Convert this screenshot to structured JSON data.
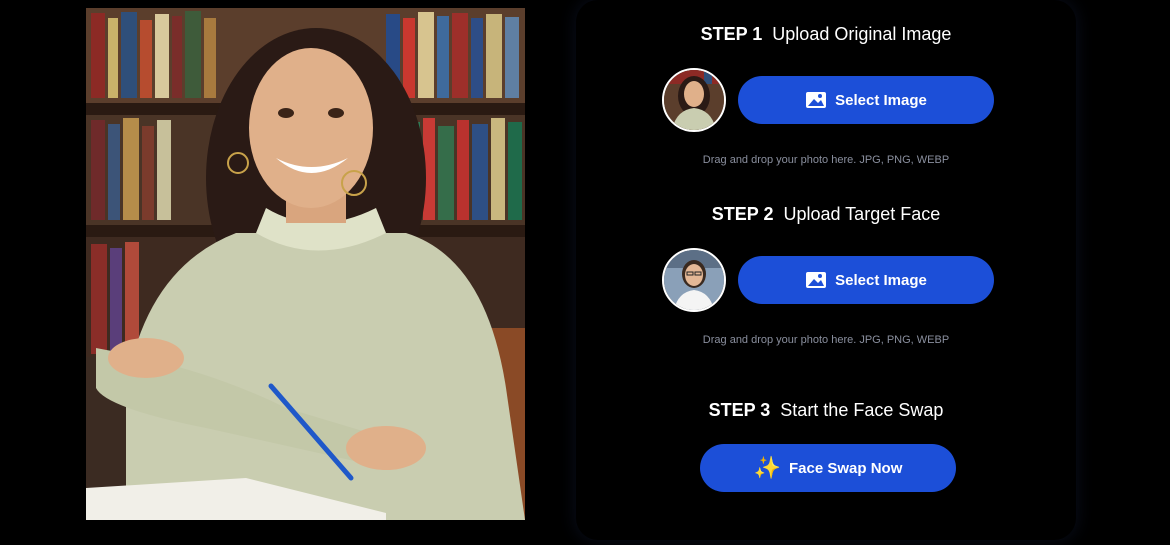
{
  "steps": [
    {
      "number": "STEP 1",
      "title": "Upload Original Image",
      "button_label": "Select Image",
      "hint": "Drag and drop your photo here. JPG, PNG, WEBP"
    },
    {
      "number": "STEP 2",
      "title": "Upload Target Face",
      "button_label": "Select Image",
      "hint": "Drag and drop your photo here. JPG, PNG, WEBP"
    },
    {
      "number": "STEP 3",
      "title": "Start the Face Swap",
      "button_label": "Face Swap Now"
    }
  ],
  "icons": {
    "select": "image-icon",
    "swap": "sparkles-icon"
  },
  "colors": {
    "accent": "#1c4fd8",
    "background": "#000000",
    "hint": "#8a8f9e",
    "sparkle": "#f6c23a"
  }
}
